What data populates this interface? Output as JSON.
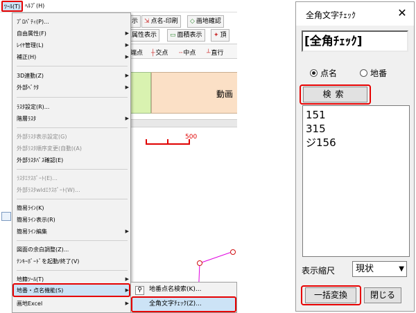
{
  "menubar": {
    "tool_label": "ﾂｰﾙ(T)",
    "help_label": "ﾍﾙﾌﾟ(H)"
  },
  "toolbar": {
    "row1": [
      "示",
      "点名-印刷",
      "画地確認"
    ],
    "row2": [
      "属性表示",
      "面積表示",
      "頂"
    ],
    "snaps": [
      "端点",
      "交点",
      "中点",
      "直行"
    ]
  },
  "canvas": {
    "peach_label": "動画",
    "ruler_label": "500",
    "accent_color": "#e00000",
    "green_fill": "#d9f2b0",
    "peach_fill": "#fbe0c6"
  },
  "menu": {
    "items": [
      {
        "label": "ﾌﾟﾛﾊﾟﾃｨ(P)...",
        "enabled": true,
        "submenu": false
      },
      {
        "label": "自由属性(F)",
        "enabled": true,
        "submenu": true
      },
      {
        "label": "ﾚｲﾔ管理(L)",
        "enabled": true,
        "submenu": true
      },
      {
        "label": "補正(H)",
        "enabled": true,
        "submenu": true
      },
      {
        "label": "3D連動(Z)",
        "enabled": true,
        "submenu": true
      },
      {
        "label": "外部ﾍﾞｸﾀ",
        "enabled": true,
        "submenu": true
      },
      {
        "label": "ﾗｽﾀ設定(R)...",
        "enabled": true,
        "submenu": false
      },
      {
        "label": "階層ﾗｽﾀ",
        "enabled": true,
        "submenu": true
      },
      {
        "label": "外部ﾗｽﾀ表示設定(G)",
        "enabled": false,
        "submenu": false
      },
      {
        "label": "外部ﾗｽﾀ順序変更(自動)(A)",
        "enabled": false,
        "submenu": false
      },
      {
        "label": "外部ﾗｽﾀﾊﾟｽ確認(E)",
        "enabled": true,
        "submenu": false
      },
      {
        "label": "ﾗｽﾀｴｸｽﾎﾟｰﾄ(E)...",
        "enabled": false,
        "submenu": false
      },
      {
        "label": "外部ﾗｽﾀwldｴｸｽﾎﾟｰﾄ(W)...",
        "enabled": false,
        "submenu": false
      },
      {
        "label": "簡易ﾗｲﾝ(K)",
        "enabled": true,
        "submenu": false
      },
      {
        "label": "簡易ﾗｲﾝ表示(R)",
        "enabled": true,
        "submenu": false
      },
      {
        "label": "簡易ﾗｲﾝ編集",
        "enabled": true,
        "submenu": true
      },
      {
        "label": "図面の余白調整(Z)...",
        "enabled": true,
        "submenu": false
      },
      {
        "label": "ﾃﾝｷｰﾎﾞｰﾄﾞを起動/終了(V)",
        "enabled": true,
        "submenu": false
      },
      {
        "label": "地籍ﾂｰﾙ(T)",
        "enabled": true,
        "submenu": true
      },
      {
        "label": "地番・点名機能(S)",
        "enabled": true,
        "submenu": true,
        "highlighted": true
      },
      {
        "label": "画地Excel",
        "enabled": true,
        "submenu": true
      }
    ]
  },
  "submenu": {
    "items": [
      {
        "label": "地番点名検索(K)...",
        "icon": "search-icon"
      },
      {
        "label": "全角文字ﾁｪｯｸ(Z)...",
        "highlighted": true
      }
    ]
  },
  "dialog": {
    "title": "全角文字ﾁｪｯｸ",
    "close_glyph": "✕",
    "heading": "[全角ﾁｪｯｸ]",
    "radio_tenmei": "点名",
    "radio_chiban": "地番",
    "selected_radio": "点名",
    "search_button": "検索",
    "results": [
      "151",
      "315",
      "ジ156"
    ],
    "scale_label": "表示縮尺",
    "scale_value": "現状",
    "bulk_button": "一括変換",
    "close_button": "閉じる",
    "highlight_color": "#e60000"
  }
}
